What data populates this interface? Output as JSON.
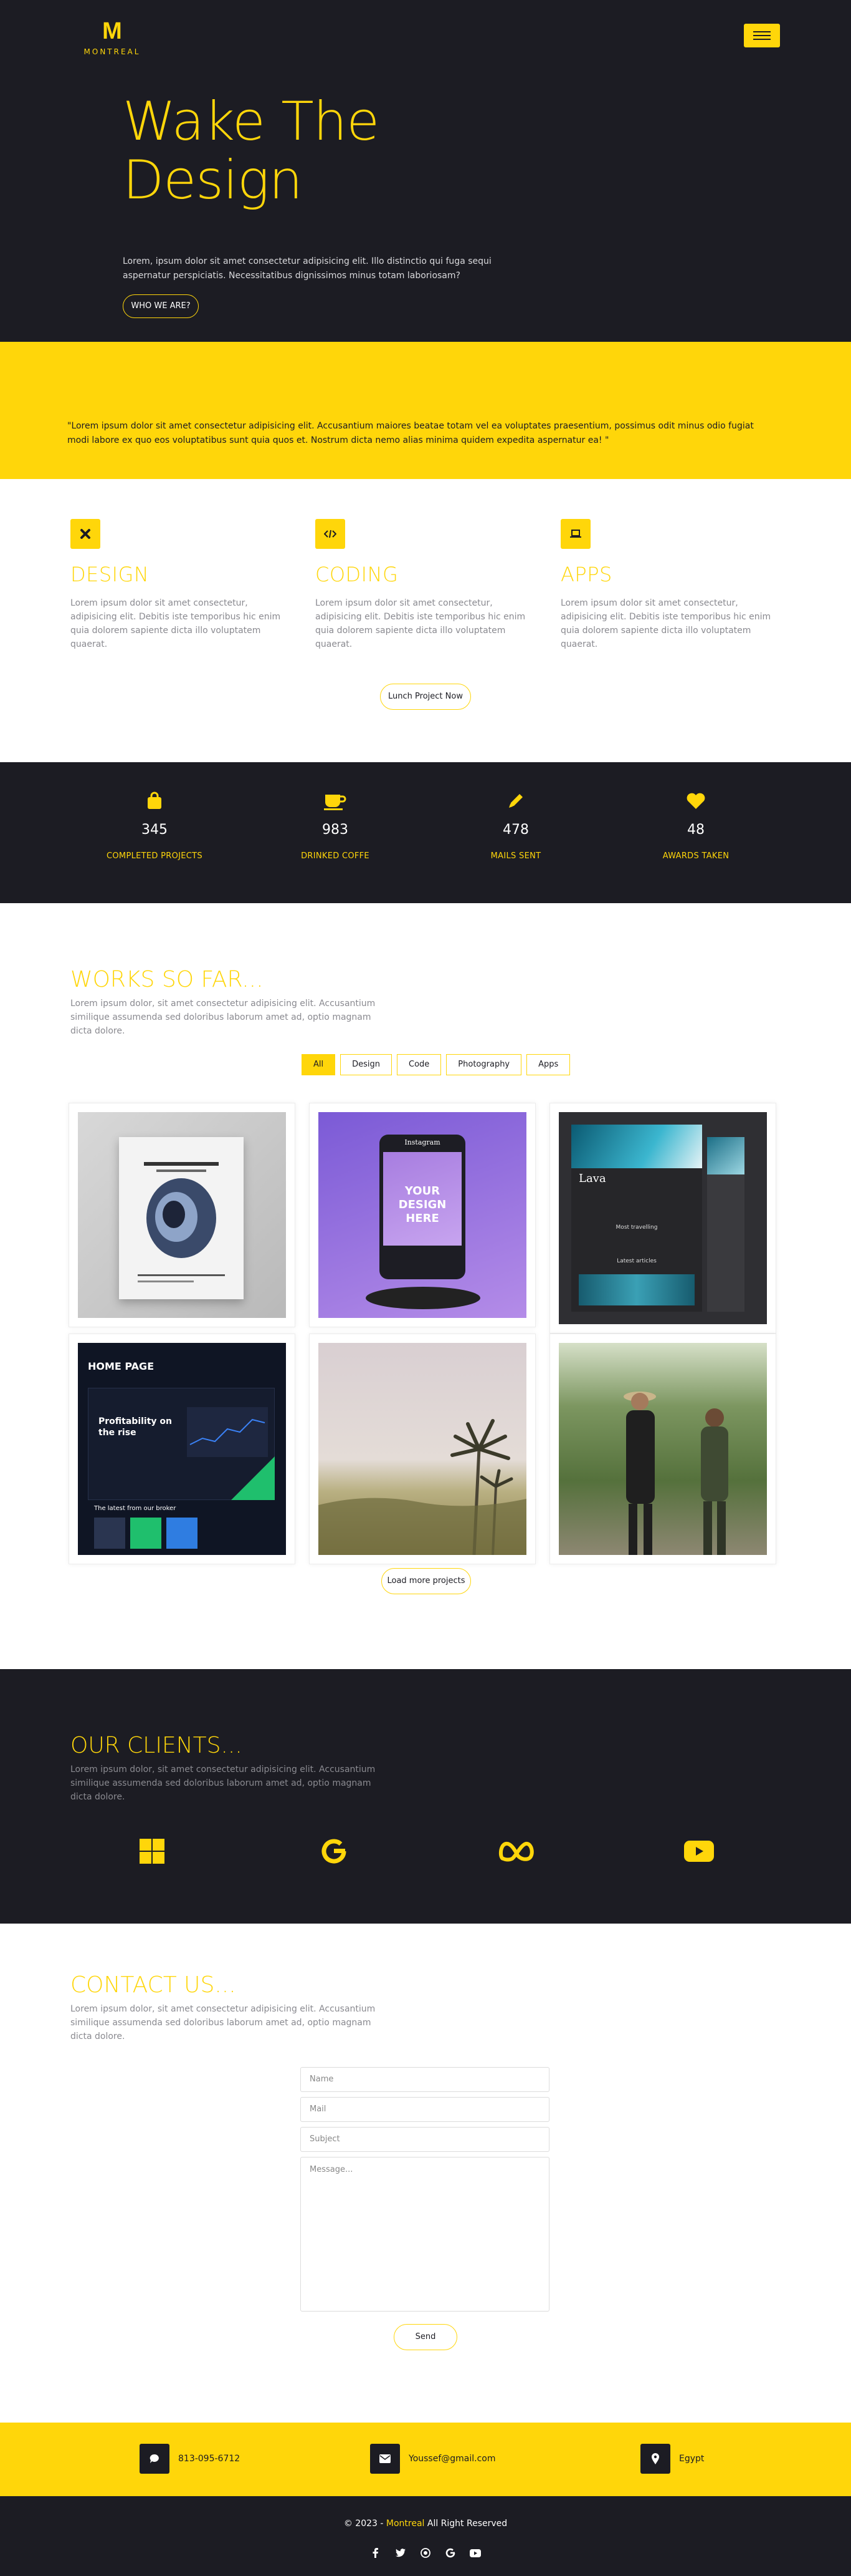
{
  "brand": {
    "logo_letter": "M",
    "logo_text": "MONTREAL"
  },
  "colors": {
    "accent": "#ffd60a",
    "dark": "#1c1c23",
    "muted": "#8a8a90"
  },
  "hero": {
    "title_line1": "Wake The",
    "title_line2": "Design",
    "text": "Lorem, ipsum dolor sit amet consectetur adipisicing elit. Illo distinctio qui fuga sequi aspernatur perspiciatis. Necessitatibus dignissimos minus totam laboriosam?",
    "button": "WHO WE ARE?",
    "menu_icon": "hamburger-icon"
  },
  "quote": {
    "text": "\"Lorem ipsum dolor sit amet consectetur adipisicing elit. Accusantium maiores beatae totam vel ea voluptates praesentium, possimus odit minus odio fugiat modi labore ex quo eos voluptatibus sunt quia quos et. Nostrum dicta nemo alias minima quidem expedita aspernatur ea! \""
  },
  "services": {
    "items": [
      {
        "icon": "tools-icon",
        "title": "DESIGN",
        "text": "Lorem ipsum dolor sit amet consectetur, adipisicing elit. Debitis iste temporibus hic enim quia dolorem sapiente dicta illo voluptatem quaerat."
      },
      {
        "icon": "code-icon",
        "title": "CODING",
        "text": "Lorem ipsum dolor sit amet consectetur, adipisicing elit. Debitis iste temporibus hic enim quia dolorem sapiente dicta illo voluptatem quaerat."
      },
      {
        "icon": "laptop-icon",
        "title": "APPS",
        "text": "Lorem ipsum dolor sit amet consectetur, adipisicing elit. Debitis iste temporibus hic enim quia dolorem sapiente dicta illo voluptatem quaerat."
      }
    ],
    "button": "Lunch Project Now"
  },
  "stats": [
    {
      "icon": "shopping-bag-icon",
      "value": "345",
      "label": "COMPLETED PROJECTS"
    },
    {
      "icon": "coffee-cup-icon",
      "value": "983",
      "label": "DRINKED COFFE"
    },
    {
      "icon": "pencil-icon",
      "value": "478",
      "label": "MAILS SENT"
    },
    {
      "icon": "heart-icon",
      "value": "48",
      "label": "AWARDS TAKEN"
    }
  ],
  "works": {
    "title": "WORKS SO FAR...",
    "subtitle": "Lorem ipsum dolor, sit amet consectetur adipisicing elit. Accusantium similique assumenda sed doloribus laborum amet ad, optio magnam dicta dolore.",
    "filters": [
      "All",
      "Design",
      "Code",
      "Photography",
      "Apps"
    ],
    "active_filter": "All",
    "cards": [
      {
        "name": "astronaut-poster"
      },
      {
        "name": "phone-mockup",
        "heading": "Instagram",
        "overlay": "YOUR DESIGN HERE"
      },
      {
        "name": "lava-website",
        "heading": "Lava",
        "sub": "Most travelling",
        "sub2": "Latest articles"
      },
      {
        "name": "home-page",
        "heading": "HOME PAGE",
        "headline": "Profitability on the rise",
        "sub": "The latest from our broker"
      },
      {
        "name": "palm-trees-photo"
      },
      {
        "name": "hikers-photo"
      }
    ],
    "load_button": "Load more projects"
  },
  "clients": {
    "title": "OUR CLIENTS...",
    "subtitle": "Lorem ipsum dolor, sit amet consectetur adipisicing elit. Accusantium similique assumenda sed doloribus laborum amet ad, optio magnam dicta dolore.",
    "logos": [
      "windows-icon",
      "google-icon",
      "meta-icon",
      "youtube-icon"
    ]
  },
  "contact": {
    "title": "CONTACT US...",
    "subtitle": "Lorem ipsum dolor, sit amet consectetur adipisicing elit. Accusantium similique assumenda sed doloribus laborum amet ad, optio magnam dicta dolore.",
    "name_placeholder": "Name",
    "mail_placeholder": "Mail",
    "subject_placeholder": "Subject",
    "message_placeholder": "Message...",
    "send": "Send"
  },
  "info": {
    "phone": "813-095-6712",
    "email": "Youssef@gmail.com",
    "location": "Egypt"
  },
  "footer": {
    "copy_prefix": "© 2023 - ",
    "brand": "Montreal",
    "copy_suffix": " All Right Reserved",
    "socials": [
      "facebook-icon",
      "twitter-icon",
      "instagram-icon",
      "google-icon",
      "youtube-icon"
    ]
  }
}
